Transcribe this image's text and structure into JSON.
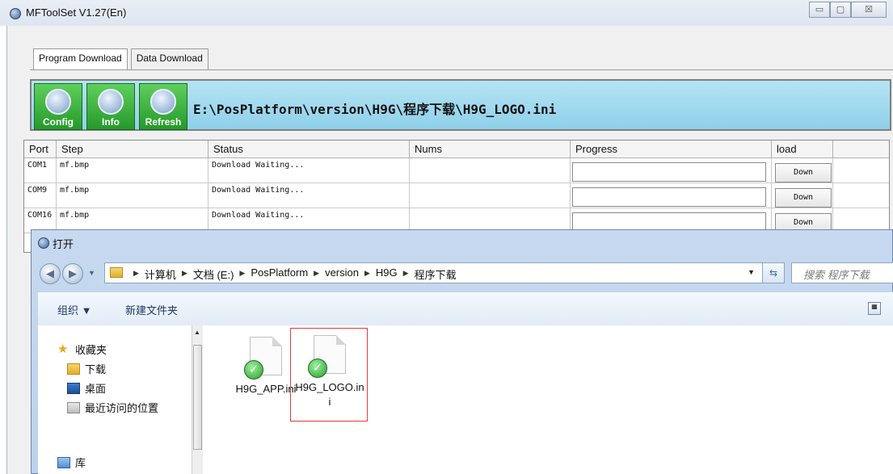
{
  "window": {
    "title": "MFToolSet V1.27(En)",
    "buttons": {
      "minimize": "▭",
      "maximize": "▢",
      "close": "☒"
    }
  },
  "tabs": [
    {
      "label": "Program Download",
      "active": true
    },
    {
      "label": "Data Download",
      "active": false
    }
  ],
  "toolbar": {
    "config_label": "Config",
    "info_label": "Info",
    "refresh_label": "Refresh",
    "path": "E:\\PosPlatform\\version\\H9G\\程序下载\\H9G_LOGO.ini"
  },
  "grid": {
    "columns": [
      "Port",
      "Step",
      "Status",
      "Nums",
      "Progress",
      "load"
    ],
    "rows": [
      {
        "port": "COM1",
        "step": "mf.bmp",
        "status": "Download Waiting...",
        "nums": "",
        "button": "Down"
      },
      {
        "port": "COM9",
        "step": "mf.bmp",
        "status": "Download Waiting...",
        "nums": "",
        "button": "Down"
      },
      {
        "port": "COM16",
        "step": "mf.bmp",
        "status": "Download Waiting...",
        "nums": "",
        "button": "Down"
      }
    ]
  },
  "dialog": {
    "title": "打开",
    "breadcrumbs": [
      "计算机",
      "文档 (E:)",
      "PosPlatform",
      "version",
      "H9G",
      "程序下载"
    ],
    "search_placeholder": "搜索 程序下载",
    "commands": {
      "organize": "组织 ▼",
      "new_folder": "新建文件夹"
    },
    "nav": {
      "favorites": "收藏夹",
      "downloads": "下载",
      "desktop": "桌面",
      "recent": "最近访问的位置",
      "library": "库"
    },
    "files": [
      {
        "name": "H9G_APP.ini",
        "selected": false
      },
      {
        "name": "H9G_LOGO.ini",
        "selected": true
      }
    ]
  },
  "colors": {
    "toolbar_bg": "#9dd8ee",
    "button_green": "#2fa833",
    "selection_border": "#e23b3b"
  }
}
